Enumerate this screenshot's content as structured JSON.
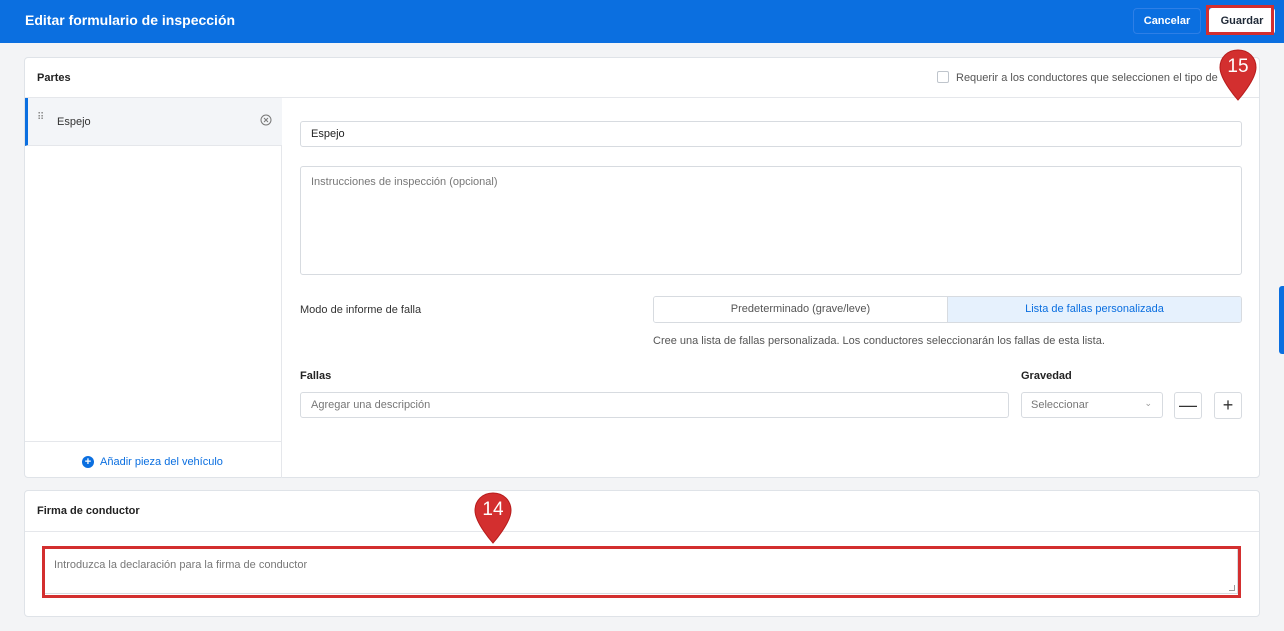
{
  "header": {
    "title": "Editar formulario de inspección",
    "cancel_label": "Cancelar",
    "save_label": "Guardar"
  },
  "parts_card": {
    "title": "Partes",
    "require_label": "Requerir a los conductores que seleccionen el tipo de",
    "require_checked": false,
    "items": [
      {
        "label": "Espejo"
      }
    ],
    "add_label": "Añadir pieza del vehículo",
    "detail": {
      "name_value": "Espejo",
      "instructions_placeholder": "Instrucciones de inspección (opcional)",
      "mode_label": "Modo de informe de falla",
      "mode_options": [
        "Predeterminado (grave/leve)",
        "Lista de fallas personalizada"
      ],
      "mode_selected": "Lista de fallas personalizada",
      "mode_help": "Cree una lista de fallas personalizada. Los conductores seleccionarán los fallas de esta lista.",
      "faults_label": "Fallas",
      "severity_label": "Gravedad",
      "fault_placeholder": "Agregar una descripción",
      "severity_placeholder": "Seleccionar"
    }
  },
  "signature_card": {
    "title": "Firma de conductor",
    "placeholder": "Introduzca la declaración para la firma de conductor"
  },
  "callouts": {
    "save": "15",
    "signature": "14"
  },
  "colors": {
    "primary": "#0b6fe0",
    "highlight": "#d32f2f"
  }
}
